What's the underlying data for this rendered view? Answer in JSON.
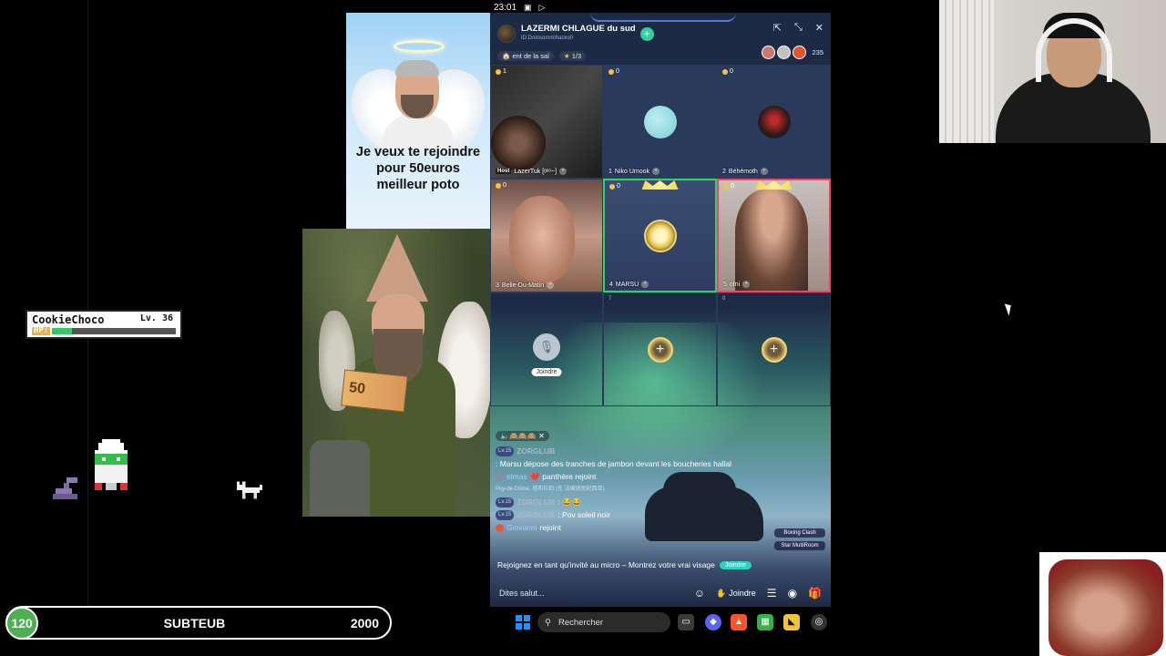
{
  "phone_status": {
    "time": "23:01"
  },
  "meme_top": {
    "caption": "Je veux te rejoindre pour 50euros meilleur poto"
  },
  "meme_elf": {
    "banknote_value": "50"
  },
  "player_card": {
    "name": "CookieChoco",
    "level": "Lv. 36",
    "hp_label": "HP:",
    "hp_fraction": 0.16
  },
  "room": {
    "title": "LAZERMI CHLAGUE du sud",
    "id": "ID:Doinsommihacko0",
    "sub_label": "ent de la sal",
    "rank": "1/3",
    "viewers": "235"
  },
  "seats": [
    {
      "coins": "1",
      "host_tag": "Host",
      "name": "LazerTuk [ᵍᵉᵒ~]"
    },
    {
      "coins": "0",
      "number": "1",
      "name": "Niko Umook"
    },
    {
      "coins": "0",
      "number": "2",
      "name": "Béhémoth"
    },
    {
      "coins": "0",
      "number": "3",
      "name": "Belle-Du-Matin"
    },
    {
      "coins": "0",
      "number": "4",
      "name": "MARSU"
    },
    {
      "coins": "0",
      "number": "5",
      "name": "ofni"
    },
    {
      "number": "",
      "join_label": "Joindre"
    },
    {
      "number": "7"
    },
    {
      "number": "8"
    }
  ],
  "chat": {
    "reactions": "🔈🙈🙈🙈",
    "messages": [
      {
        "badge": "Lv.15",
        "user": "ZORGLUB",
        "text": ": Marsu dépose des tranches de jambon devant les boucheries hallal"
      },
      {
        "user": "elmas",
        "heart": "❤️",
        "text": "panthère rejoint"
      },
      {
        "badge": "Lv.15",
        "user": "ZORGLUB",
        "text": ": 😂😂"
      },
      {
        "badge": "Lv.15",
        "user": "ZORGLUB",
        "text": ": Pov soleil noir"
      },
      {
        "user": "Giovanni",
        "text": "rejoint"
      }
    ],
    "location_line": "Puy-de-Dôme, 塔布拉伯 (在 法国迷别纪西亚)"
  },
  "invite": {
    "text": "Rejoignez en tant qu'invité au micro – Montrez votre vrai visage",
    "button": "Joindre"
  },
  "side_badges": {
    "top": "Boxing Clash",
    "bottom": "Star MultiRoom"
  },
  "bottom_bar": {
    "placeholder": "Dites salut...",
    "join": "Joindre"
  },
  "sub_counter": {
    "current": "120",
    "label": "SUBTEUB",
    "goal": "2000"
  },
  "taskbar": {
    "search_placeholder": "Rechercher"
  },
  "colors": {
    "accent_green": "#2ed2a0",
    "seat_border_green": "#34d16a",
    "seat_border_pink": "#ff3c6a",
    "windows_blue": "#1e90ff",
    "sub_circle": "#4caf50"
  }
}
